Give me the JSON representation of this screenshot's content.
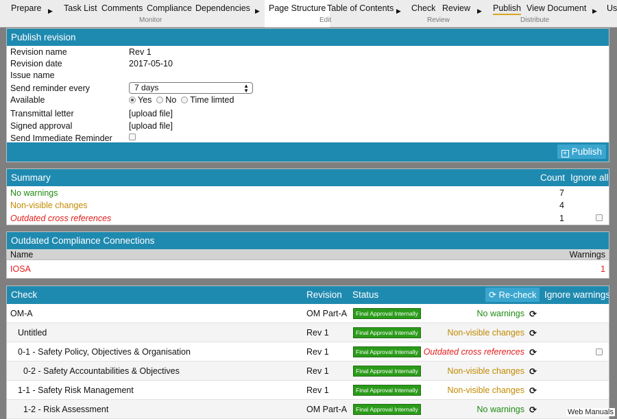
{
  "nav": {
    "prepare": "Prepare",
    "task_list": "Task List",
    "comments": "Comments",
    "compliance": "Compliance",
    "dependencies": "Dependencies",
    "page_structure": "Page Structure",
    "toc": "Table of Contents",
    "check": "Check",
    "review": "Review",
    "publish": "Publish",
    "view_document": "View Document",
    "use": "Use",
    "group_monitor": "Monitor",
    "group_edit": "Edit",
    "group_review": "Review",
    "group_distribute": "Distribute"
  },
  "publish_panel": {
    "title": "Publish revision",
    "revision_name_label": "Revision name",
    "revision_name_value": "Rev 1",
    "revision_date_label": "Revision date",
    "revision_date_value": "2017-05-10",
    "issue_name_label": "Issue name",
    "reminder_label": "Send reminder every",
    "reminder_value": "7 days",
    "available_label": "Available",
    "available_yes": "Yes",
    "available_no": "No",
    "available_time": "Time limted",
    "transmittal_label": "Transmittal letter",
    "transmittal_value": "[upload file]",
    "signed_label": "Signed approval",
    "signed_value": "[upload file]",
    "immediate_label": "Send Immediate Reminder",
    "publish_button": "Publish"
  },
  "summary": {
    "title": "Summary",
    "count_header": "Count",
    "ignore_header": "Ignore all",
    "rows": [
      {
        "label": "No warnings",
        "count": "7"
      },
      {
        "label": "Non-visible changes",
        "count": "4"
      },
      {
        "label": "Outdated cross references",
        "count": "1"
      }
    ]
  },
  "compliance": {
    "title": "Outdated Compliance Connections",
    "name_header": "Name",
    "warnings_header": "Warnings",
    "rows": [
      {
        "name": "IOSA",
        "warnings": "1"
      }
    ]
  },
  "check_table": {
    "check_header": "Check",
    "revision_header": "Revision",
    "status_header": "Status",
    "recheck_button": "Re-check",
    "ignore_header": "Ignore warnings",
    "rows": [
      {
        "name": "OM-A",
        "revision": "OM Part-A",
        "status": "Final Approval Internally",
        "result": "No warnings"
      },
      {
        "name": "Untitled",
        "revision": "Rev 1",
        "status": "Final Approval Internally",
        "result": "Non-visible changes"
      },
      {
        "name": "0-1 - Safety Policy, Objectives & Organisation",
        "revision": "Rev 1",
        "status": "Final Approval Internally",
        "result": "Outdated cross references"
      },
      {
        "name": "0-2 - Safety Accountabilities & Objectives",
        "revision": "Rev 1",
        "status": "Final Approval Internally",
        "result": "Non-visible changes"
      },
      {
        "name": "1-1 - Safety Risk Management",
        "revision": "Rev 1",
        "status": "Final Approval Internally",
        "result": "Non-visible changes"
      },
      {
        "name": "1-2 - Risk Assessment",
        "revision": "OM Part-A",
        "status": "Final Approval Internally",
        "result": "No warnings"
      }
    ]
  },
  "brand": "Web Manuals",
  "colors": {
    "header_blue": "#1f8ab0",
    "button_blue": "#3aa6cf",
    "ok_green": "#1f8a12",
    "warn_amber": "#c28a00",
    "error_red": "#e31b1b",
    "badge_green": "#2b9b1a"
  }
}
